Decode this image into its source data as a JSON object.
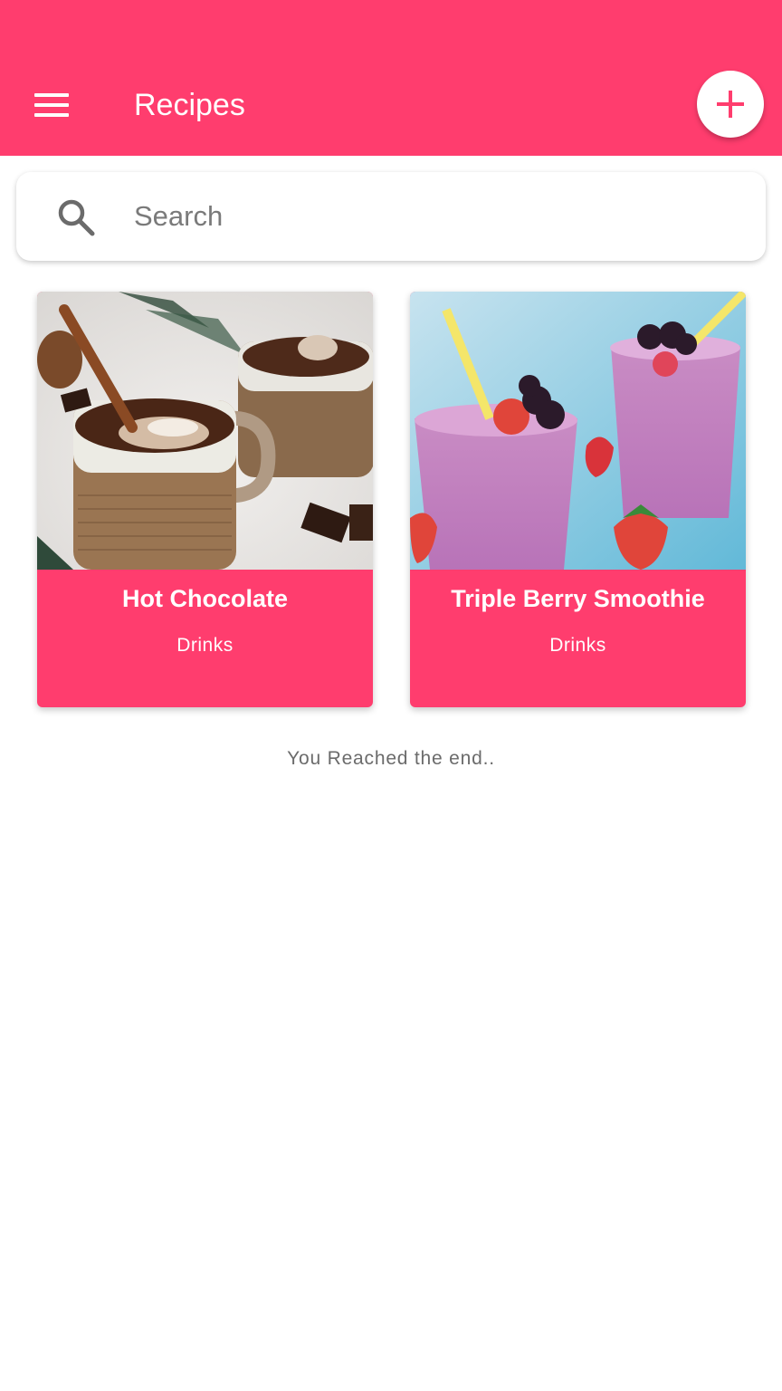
{
  "app_bar": {
    "title": "Recipes",
    "background_color": "#ff3d6e",
    "menu_icon": "hamburger-menu-icon",
    "add_icon": "plus-icon"
  },
  "search": {
    "placeholder": "Search",
    "value": "",
    "icon": "search-icon"
  },
  "recipes": [
    {
      "title": "Hot Chocolate",
      "category": "Drinks",
      "image": "hot-chocolate-photo"
    },
    {
      "title": "Triple Berry Smoothie",
      "category": "Drinks",
      "image": "berry-smoothie-photo"
    }
  ],
  "footer": {
    "end_message": "You Reached the end.."
  }
}
